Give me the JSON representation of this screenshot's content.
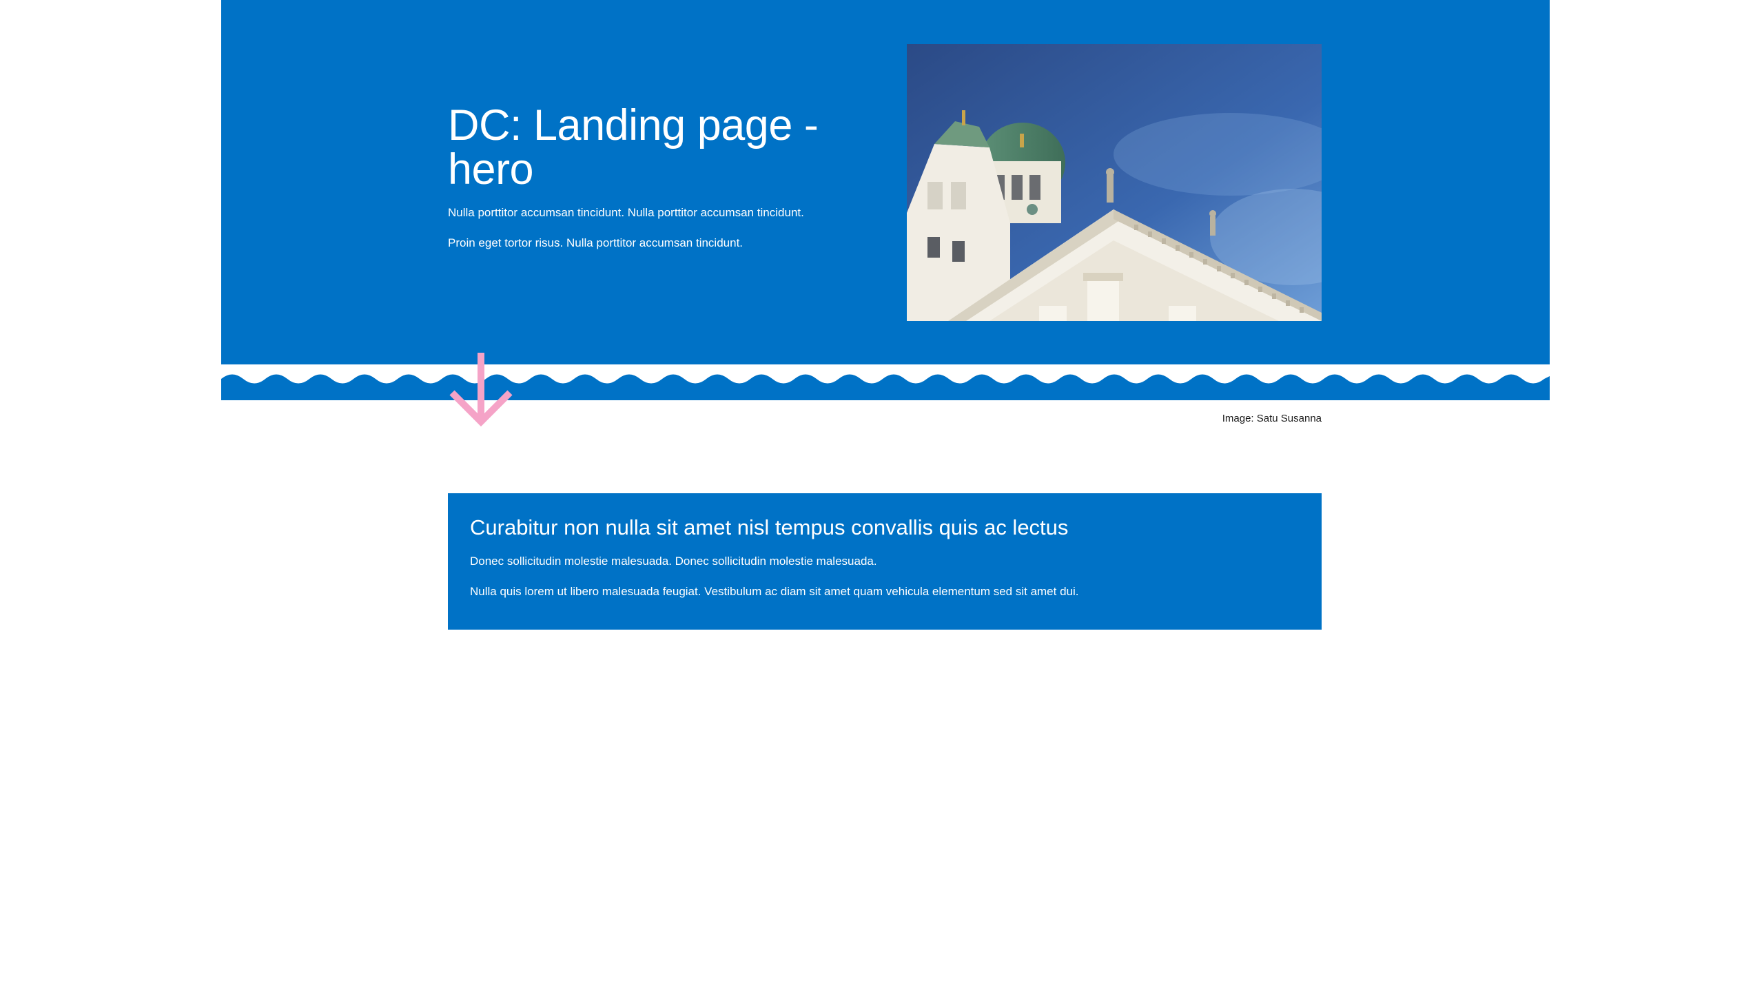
{
  "hero": {
    "title": "DC: Landing page - hero",
    "paragraphs": [
      "Nulla porttitor accumsan tincidunt. Nulla porttitor accumsan tincidunt.",
      "Proin eget tortor risus. Nulla porttitor accumsan tincidunt."
    ],
    "image_icon": "cathedral-photo",
    "image_caption": "Image: Satu Susanna",
    "background_color": "#0072c6"
  },
  "scroll_arrow": {
    "icon": "arrow-down-icon",
    "color": "#f5a3c7"
  },
  "info_box": {
    "title": "Curabitur non nulla sit amet nisl tempus convallis quis ac lectus",
    "paragraphs": [
      "Donec sollicitudin molestie malesuada. Donec sollicitudin molestie malesuada.",
      "Nulla quis lorem ut libero malesuada feugiat. Vestibulum ac diam sit amet quam vehicula elementum sed sit amet dui."
    ],
    "background_color": "#0072c6"
  }
}
